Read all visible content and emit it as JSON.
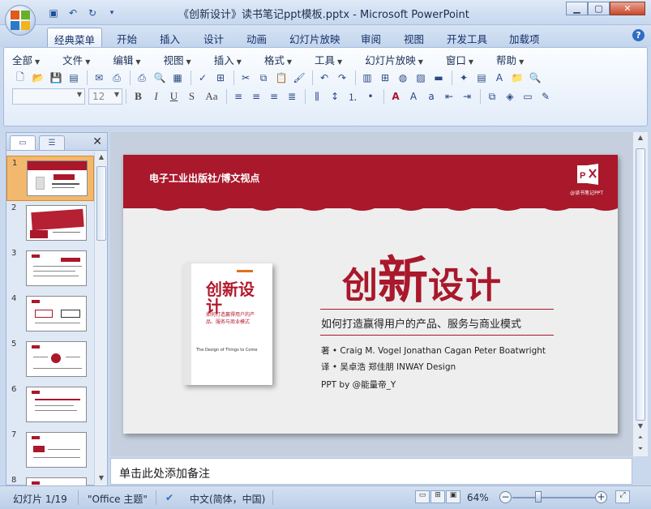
{
  "window": {
    "title": "《创新设计》读书笔记ppt模板.pptx - Microsoft PowerPoint",
    "minimize_icon": "minimize-icon",
    "maximize_icon": "maximize-icon",
    "close_icon": "close-icon"
  },
  "quick_access": [
    "save-icon",
    "undo-icon",
    "redo-icon",
    "customize-icon"
  ],
  "ribbon_tabs": [
    {
      "label": "经典菜单",
      "active": true
    },
    {
      "label": "开始"
    },
    {
      "label": "插入"
    },
    {
      "label": "设计"
    },
    {
      "label": "动画"
    },
    {
      "label": "幻灯片放映"
    },
    {
      "label": "审阅"
    },
    {
      "label": "视图"
    },
    {
      "label": "开发工具"
    },
    {
      "label": "加载项"
    }
  ],
  "classic_menu": [
    "全部",
    "文件",
    "编辑",
    "视图",
    "插入",
    "格式",
    "工具",
    "幻灯片放映",
    "窗口",
    "帮助"
  ],
  "format_bar": {
    "font_name": "",
    "font_size": "12",
    "bold": "B",
    "italic": "I",
    "underline": "U",
    "shadow": "S",
    "case": "Aa"
  },
  "slide_pane": {
    "slides": [
      {
        "number": "1",
        "selected": true
      },
      {
        "number": "2"
      },
      {
        "number": "3"
      },
      {
        "number": "4"
      },
      {
        "number": "5"
      },
      {
        "number": "6"
      },
      {
        "number": "7"
      },
      {
        "number": "8"
      }
    ]
  },
  "slide": {
    "publisher": "电子工业出版社/博文视点",
    "brand_text": "@读书笔记PPT",
    "title_left": "创",
    "title_big": "新",
    "title_right": "设计",
    "subtitle": "如何打造赢得用户的产品、服务与商业模式",
    "authors": "著 • Craig M. Vogel  Jonathan Cagan  Peter Boatwright",
    "translators": "译 • 吴卓浩  郑佳朋  INWAY Design",
    "ppt_by": "PPT by @能量帝_Y",
    "book_cover": {
      "title": "创新设计",
      "subtitle": "如何打造赢得用户的产品、服务与商业模式",
      "english": "The Design of Things to Come"
    },
    "accent_color": "#a9182b"
  },
  "notes": {
    "placeholder": "单击此处添加备注"
  },
  "status": {
    "slide_counter": "幻灯片 1/19",
    "theme": "\"Office 主题\"",
    "language": "中文(简体，中国)",
    "zoom": "64%",
    "zoom_level_percent": 64
  }
}
